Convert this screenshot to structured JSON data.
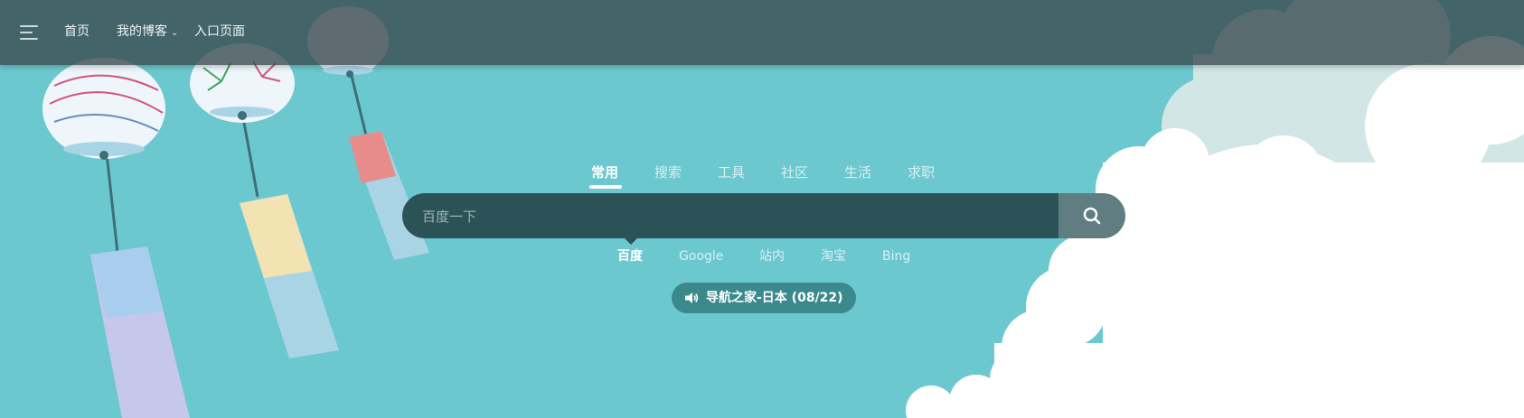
{
  "nav": {
    "items": [
      {
        "label": "首页"
      },
      {
        "label": "我的博客",
        "has_dropdown": true
      },
      {
        "label": "入口页面"
      }
    ]
  },
  "search": {
    "tabs": [
      {
        "label": "常用",
        "active": true
      },
      {
        "label": "搜索"
      },
      {
        "label": "工具"
      },
      {
        "label": "社区"
      },
      {
        "label": "生活"
      },
      {
        "label": "求职"
      }
    ],
    "placeholder": "百度一下",
    "engines": [
      {
        "label": "百度",
        "active": true
      },
      {
        "label": "Google"
      },
      {
        "label": "站内"
      },
      {
        "label": "淘宝"
      },
      {
        "label": "Bing"
      }
    ]
  },
  "notice": {
    "text": "导航之家-日本 (08/22)"
  },
  "colors": {
    "background": "#6cc8cf",
    "header": "#37484b",
    "search_box": "#2b5257",
    "notice_pill": "#3a8a8d"
  }
}
